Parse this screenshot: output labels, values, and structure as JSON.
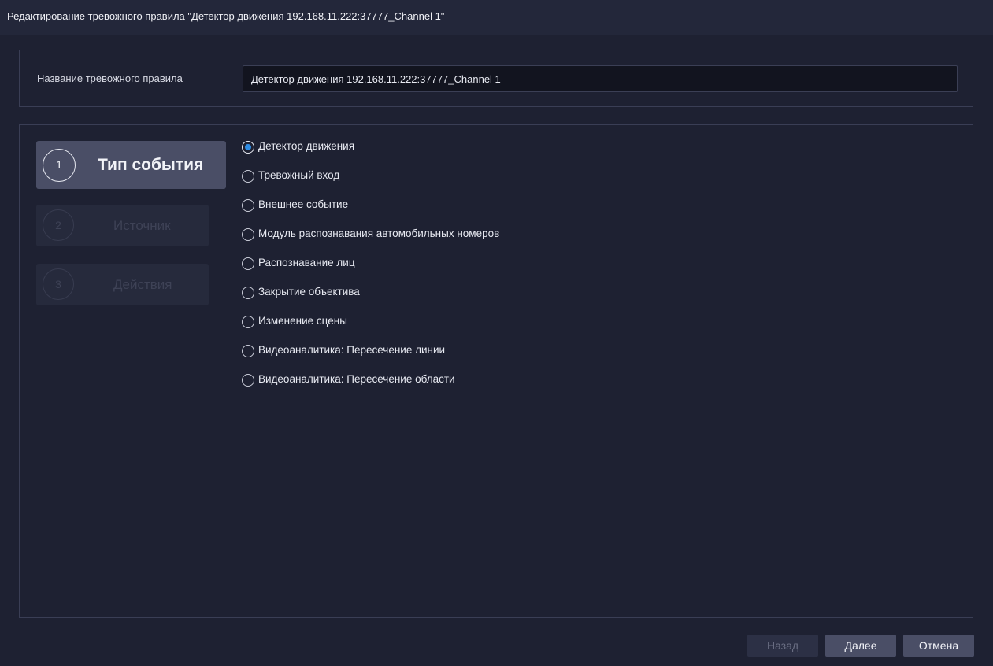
{
  "window": {
    "title": "Редактирование тревожного правила \"Детектор движения 192.168.11.222:37777_Channel 1\""
  },
  "rule_name": {
    "label": "Название тревожного правила",
    "value": "Детектор движения 192.168.11.222:37777_Channel 1"
  },
  "steps": [
    {
      "number": "1",
      "label": "Тип события",
      "active": true
    },
    {
      "number": "2",
      "label": "Источник",
      "active": false
    },
    {
      "number": "3",
      "label": "Действия",
      "active": false
    }
  ],
  "event_types": {
    "selected_index": 0,
    "options": [
      "Детектор движения",
      "Тревожный вход",
      "Внешнее событие",
      "Модуль распознавания автомобильных номеров",
      "Распознавание лиц",
      "Закрытие объектива",
      "Изменение сцены",
      "Видеоаналитика: Пересечение линии",
      "Видеоаналитика: Пересечение области"
    ]
  },
  "footer": {
    "back_label": "Назад",
    "next_label": "Далее",
    "cancel_label": "Отмена"
  },
  "colors": {
    "accent": "#2f8de4",
    "background": "#1e2132",
    "active_step": "#4a4e66"
  }
}
